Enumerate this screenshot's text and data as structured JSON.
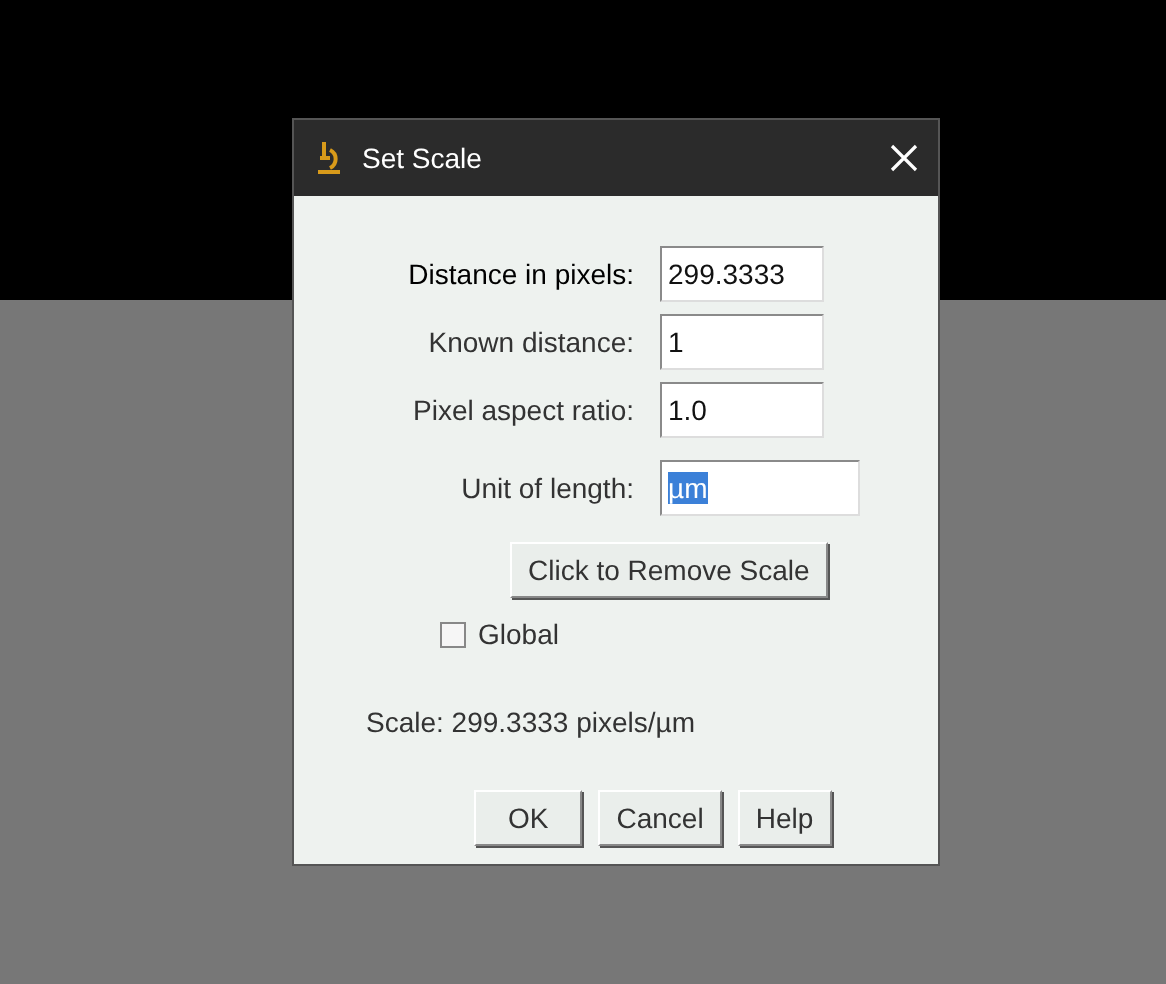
{
  "window": {
    "title": "Set Scale"
  },
  "fields": [
    {
      "label": "Distance in pixels:",
      "value": "299.3333",
      "text_selected": false,
      "wide": false
    },
    {
      "label": "Known distance:",
      "value": "1",
      "text_selected": false,
      "wide": false
    },
    {
      "label": "Pixel aspect ratio:",
      "value": "1.0",
      "text_selected": false,
      "wide": false
    },
    {
      "label": "Unit of length:",
      "value": "µm",
      "text_selected": true,
      "wide": true
    }
  ],
  "remove_button": "Click to Remove Scale",
  "global_checkbox": {
    "label": "Global",
    "checked": false
  },
  "scale_text": "Scale: 299.3333 pixels/µm",
  "buttons": [
    "OK",
    "Cancel",
    "Help"
  ]
}
